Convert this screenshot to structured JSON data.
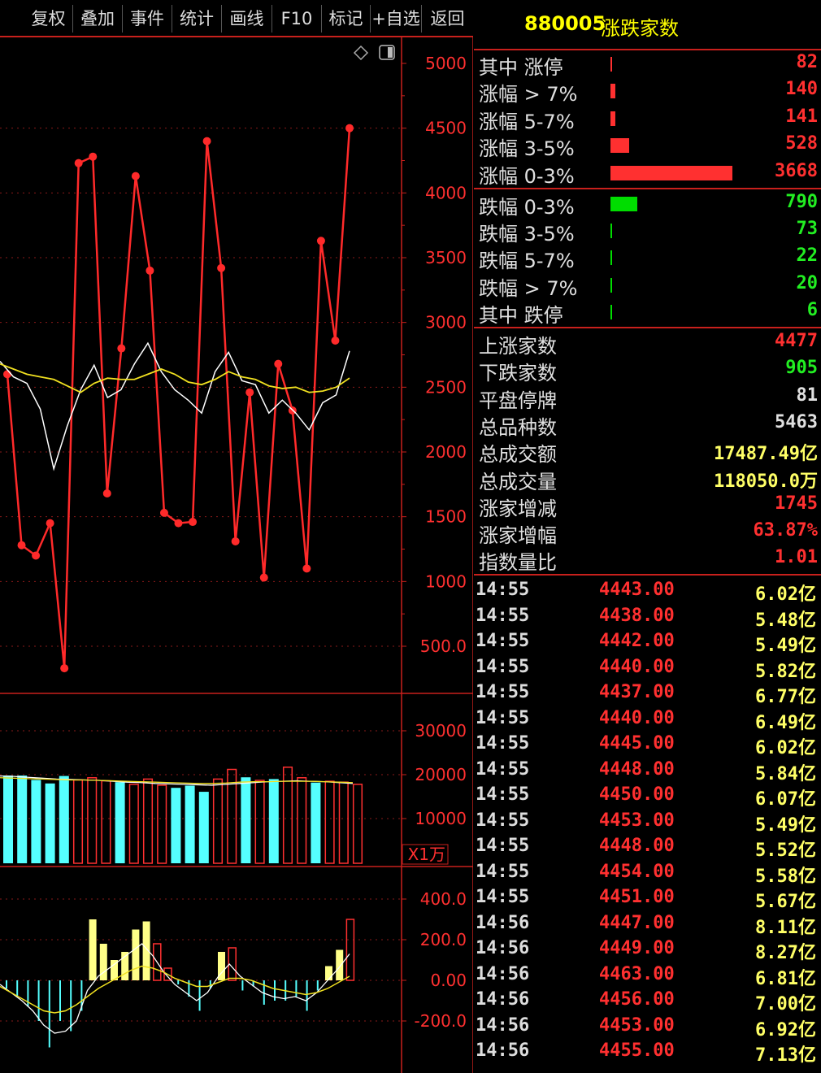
{
  "toolbar": {
    "buttons": [
      "复权",
      "叠加",
      "事件",
      "统计",
      "画线",
      "F10",
      "标记",
      "+自选",
      "返回"
    ]
  },
  "panel": {
    "code": "880005",
    "name": "涨跌家数",
    "up_rows": [
      {
        "label": "其中 涨停",
        "value": "82",
        "bar": 0.016
      },
      {
        "label": "涨幅 > 7%",
        "value": "140",
        "bar": 0.04
      },
      {
        "label": "涨幅 5-7%",
        "value": "141",
        "bar": 0.04
      },
      {
        "label": "涨幅 3-5%",
        "value": "528",
        "bar": 0.15
      },
      {
        "label": "涨幅 0-3%",
        "value": "3668",
        "bar": 1.0
      }
    ],
    "down_rows": [
      {
        "label": "跌幅 0-3%",
        "value": "790",
        "bar": 0.22
      },
      {
        "label": "跌幅 3-5%",
        "value": "73",
        "bar": 0.016
      },
      {
        "label": "跌幅 5-7%",
        "value": "22",
        "bar": 0.016
      },
      {
        "label": "跌幅 > 7%",
        "value": "20",
        "bar": 0.016
      },
      {
        "label": "其中 跌停",
        "value": "6",
        "bar": 0.016
      }
    ],
    "stats": [
      {
        "label": "上涨家数",
        "value": "4477",
        "color": "#ff3030"
      },
      {
        "label": "下跌家数",
        "value": "905",
        "color": "#22ee22"
      },
      {
        "label": "平盘停牌",
        "value": "81",
        "color": "#e0e0e0"
      },
      {
        "label": "总品种数",
        "value": "5463",
        "color": "#e0e0e0"
      },
      {
        "label": "总成交额",
        "value": "17487.49亿",
        "color": "#ffff66"
      },
      {
        "label": "总成交量",
        "value": "118050.0万",
        "color": "#ffff66"
      },
      {
        "label": "涨家增减",
        "value": "1745",
        "color": "#ff3030"
      },
      {
        "label": "涨家增幅",
        "value": "63.87%",
        "color": "#ff3030"
      },
      {
        "label": "指数量比",
        "value": "1.01",
        "color": "#ff3030"
      }
    ],
    "ticks": [
      {
        "t": "14:55",
        "p": "4443.00",
        "v": "6.02亿"
      },
      {
        "t": "14:55",
        "p": "4438.00",
        "v": "5.48亿"
      },
      {
        "t": "14:55",
        "p": "4442.00",
        "v": "5.49亿"
      },
      {
        "t": "14:55",
        "p": "4440.00",
        "v": "5.82亿"
      },
      {
        "t": "14:55",
        "p": "4437.00",
        "v": "6.77亿"
      },
      {
        "t": "14:55",
        "p": "4440.00",
        "v": "6.49亿"
      },
      {
        "t": "14:55",
        "p": "4445.00",
        "v": "6.02亿"
      },
      {
        "t": "14:55",
        "p": "4448.00",
        "v": "5.84亿"
      },
      {
        "t": "14:55",
        "p": "4450.00",
        "v": "6.07亿"
      },
      {
        "t": "14:55",
        "p": "4453.00",
        "v": "5.49亿"
      },
      {
        "t": "14:55",
        "p": "4448.00",
        "v": "5.52亿"
      },
      {
        "t": "14:55",
        "p": "4454.00",
        "v": "5.58亿"
      },
      {
        "t": "14:55",
        "p": "4451.00",
        "v": "5.67亿"
      },
      {
        "t": "14:56",
        "p": "4447.00",
        "v": "8.11亿"
      },
      {
        "t": "14:56",
        "p": "4449.00",
        "v": "8.27亿"
      },
      {
        "t": "14:56",
        "p": "4463.00",
        "v": "6.81亿"
      },
      {
        "t": "14:56",
        "p": "4456.00",
        "v": "7.00亿"
      },
      {
        "t": "14:56",
        "p": "4453.00",
        "v": "6.92亿"
      },
      {
        "t": "14:56",
        "p": "4455.00",
        "v": "7.13亿"
      }
    ]
  },
  "chart_data": [
    {
      "type": "line",
      "yticks": [
        "5000",
        "4500",
        "4000",
        "3500",
        "3000",
        "2500",
        "2000",
        "1500",
        "1000",
        "500.0"
      ],
      "ylim": [
        0,
        5000
      ],
      "series": [
        {
          "values": [
            2600,
            1280,
            1200,
            1450,
            330,
            4230,
            4280,
            1680,
            2800,
            4130,
            3400,
            1530,
            1450,
            1460,
            4400,
            3420,
            1310,
            2460,
            1030,
            2680,
            2320,
            1100,
            3630,
            2860,
            4500
          ],
          "color": "#ff2a2a"
        },
        {
          "values": [
            2700,
            2580,
            2530,
            2330,
            1870,
            2200,
            2480,
            2670,
            2420,
            2480,
            2680,
            2840,
            2620,
            2480,
            2400,
            2300,
            2620,
            2770,
            2550,
            2520,
            2300,
            2400,
            2300,
            2170,
            2380,
            2440,
            2780
          ],
          "color": "#ffffff"
        },
        {
          "values": [
            2680,
            2640,
            2600,
            2580,
            2560,
            2510,
            2460,
            2530,
            2570,
            2560,
            2560,
            2600,
            2640,
            2600,
            2540,
            2520,
            2560,
            2620,
            2580,
            2560,
            2510,
            2490,
            2500,
            2460,
            2470,
            2500,
            2570
          ],
          "color": "#f0e020"
        }
      ]
    },
    {
      "type": "bar",
      "yticks": [
        "30000",
        "20000",
        "10000"
      ],
      "unit": "X1万",
      "ylim": [
        0,
        38000
      ],
      "bars": [
        {
          "v": 19800,
          "c": "cyan"
        },
        {
          "v": 19800,
          "c": "cyan"
        },
        {
          "v": 18800,
          "c": "cyan"
        },
        {
          "v": 18000,
          "c": "cyan"
        },
        {
          "v": 19700,
          "c": "cyan"
        },
        {
          "v": 18800,
          "c": "red"
        },
        {
          "v": 19300,
          "c": "red"
        },
        {
          "v": 18600,
          "c": "red"
        },
        {
          "v": 18300,
          "c": "cyan"
        },
        {
          "v": 17800,
          "c": "red"
        },
        {
          "v": 19000,
          "c": "red"
        },
        {
          "v": 17600,
          "c": "red"
        },
        {
          "v": 17000,
          "c": "cyan"
        },
        {
          "v": 17500,
          "c": "cyan"
        },
        {
          "v": 16100,
          "c": "cyan"
        },
        {
          "v": 19000,
          "c": "red"
        },
        {
          "v": 21200,
          "c": "red"
        },
        {
          "v": 19400,
          "c": "cyan"
        },
        {
          "v": 18700,
          "c": "red"
        },
        {
          "v": 19000,
          "c": "cyan"
        },
        {
          "v": 21700,
          "c": "red"
        },
        {
          "v": 19300,
          "c": "red"
        },
        {
          "v": 18200,
          "c": "cyan"
        },
        {
          "v": 18500,
          "c": "red"
        },
        {
          "v": 18300,
          "c": "red"
        },
        {
          "v": 17800,
          "c": "red"
        }
      ],
      "ma": [
        {
          "values": [
            19700,
            19600,
            19400,
            19200,
            19000,
            18900,
            18800,
            18700,
            18500,
            18300,
            18200,
            18000,
            17900,
            17800,
            17700,
            17600,
            17800,
            18000,
            18200,
            18400,
            18500,
            18600,
            18500,
            18400,
            18200,
            18000
          ],
          "color": "#ffffff"
        },
        {
          "values": [
            19300,
            19200,
            19100,
            19000,
            18900,
            18800,
            18800,
            18700,
            18600,
            18500,
            18400,
            18300,
            18200,
            18100,
            18000,
            18000,
            18100,
            18300,
            18400,
            18400,
            18500,
            18500,
            18500,
            18400,
            18300,
            18200
          ],
          "color": "#f0e020"
        }
      ]
    },
    {
      "type": "bar",
      "yticks": [
        "400.0",
        "200.0",
        "0.00",
        "-200.0"
      ],
      "ylim": [
        -400,
        400
      ],
      "bars": [
        -40,
        -80,
        -130,
        -200,
        -330,
        -200,
        -250,
        -150,
        300,
        180,
        100,
        140,
        250,
        290,
        180,
        60,
        -20,
        -80,
        -150,
        -40,
        140,
        160,
        -50,
        -30,
        -120,
        -100,
        -100,
        -80,
        -150,
        -50,
        70,
        150,
        300
      ],
      "ma": [
        {
          "values": [
            -20,
            -60,
            -100,
            -150,
            -220,
            -260,
            -250,
            -200,
            -50,
            20,
            60,
            100,
            140,
            180,
            120,
            40,
            -20,
            -60,
            -100,
            -60,
            20,
            80,
            20,
            -20,
            -60,
            -80,
            -90,
            -80,
            -100,
            -60,
            0,
            60,
            130
          ],
          "color": "#ffffff"
        },
        {
          "values": [
            -30,
            -60,
            -90,
            -120,
            -150,
            -160,
            -150,
            -120,
            -80,
            -40,
            -10,
            20,
            50,
            70,
            60,
            40,
            10,
            -10,
            -30,
            -30,
            -10,
            10,
            10,
            0,
            -20,
            -40,
            -50,
            -60,
            -70,
            -60,
            -40,
            -10,
            20
          ],
          "color": "#f0e020"
        }
      ]
    }
  ]
}
